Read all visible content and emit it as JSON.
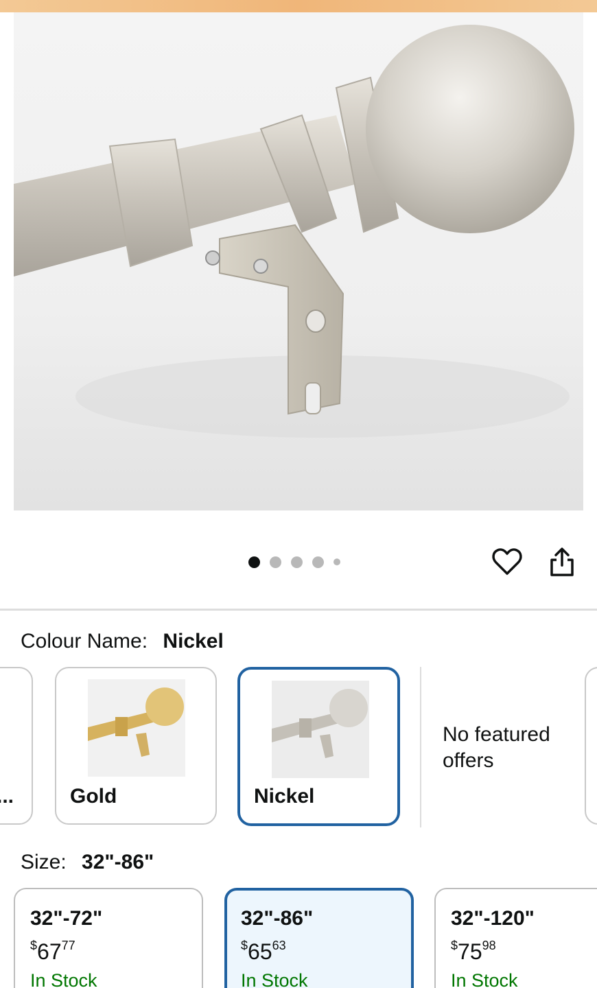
{
  "gallery": {
    "image_alt": "Nickel curtain rod with ball finial and wall bracket",
    "slide_count": 5,
    "active_slide": 1
  },
  "actions": {
    "wishlist_icon": "heart-icon",
    "share_icon": "share-icon"
  },
  "colour": {
    "label": "Colour Name:",
    "selected": "Nickel",
    "options": [
      {
        "label": "..."
      },
      {
        "label": "Gold"
      },
      {
        "label": "Nickel"
      }
    ],
    "no_offers_line1": "No featured",
    "no_offers_line2": "offers"
  },
  "size": {
    "label": "Size:",
    "selected": "32\"-86\"",
    "options": [
      {
        "size": "32\"-72\"",
        "currency": "$",
        "dollars": "67",
        "cents": "77",
        "stock": "In Stock"
      },
      {
        "size": "32\"-86\"",
        "currency": "$",
        "dollars": "65",
        "cents": "63",
        "stock": "In Stock"
      },
      {
        "size": "32\"-120\"",
        "currency": "$",
        "dollars": "75",
        "cents": "98",
        "stock": "In Stock"
      }
    ]
  },
  "colors": {
    "accent_blue": "#2162a1",
    "in_stock_green": "#007600",
    "top_strip": "#f0b679"
  }
}
